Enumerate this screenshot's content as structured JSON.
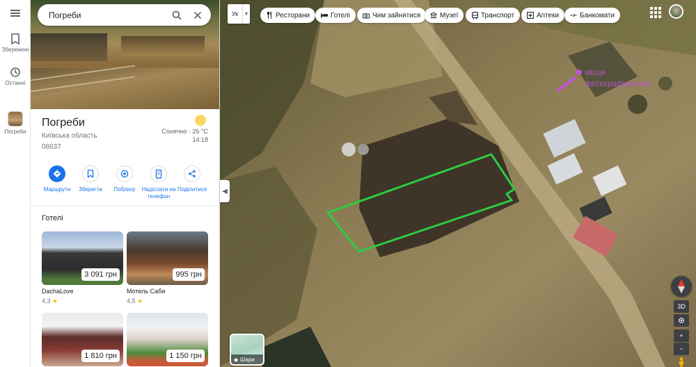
{
  "search": {
    "query": "Погреби"
  },
  "rail": {
    "saved_label": "Збережені",
    "recent_label": "Останні",
    "current_label": "Погреби"
  },
  "place": {
    "title": "Погреби",
    "region": "Київська область",
    "postal_code": "08637",
    "weather": {
      "condition_temp": "Сонячно · 26 °C",
      "time": "14:18",
      "icon": "sun-icon"
    }
  },
  "actions": [
    {
      "label": "Маршрути",
      "icon": "directions-icon"
    },
    {
      "label": "Зберегти",
      "icon": "bookmark-icon"
    },
    {
      "label": "Поблизу",
      "icon": "nearby-icon"
    },
    {
      "label": "Надіслати на телефон",
      "icon": "send-to-phone-icon"
    },
    {
      "label": "Поділитися",
      "icon": "share-icon"
    }
  ],
  "hotels": {
    "title": "Готелі",
    "items": [
      {
        "name": "DachaLove",
        "price": "3 091 грн",
        "rating": "4,3"
      },
      {
        "name": "Мотель Саби",
        "price": "995 грн",
        "rating": "4,5"
      },
      {
        "name": "",
        "price": "1 810 грн",
        "rating": ""
      },
      {
        "name": "",
        "price": "1 150 грн",
        "rating": ""
      }
    ]
  },
  "map": {
    "language_code": "Ук",
    "chips": [
      {
        "label": "Ресторани",
        "icon": "restaurant-icon"
      },
      {
        "label": "Готелі",
        "icon": "hotel-icon"
      },
      {
        "label": "Чим зайнятися",
        "icon": "camera-icon"
      },
      {
        "label": "Музеї",
        "icon": "museum-icon"
      },
      {
        "label": "Транспорт",
        "icon": "transit-icon"
      },
      {
        "label": "Аптеки",
        "icon": "pharmacy-icon"
      },
      {
        "label": "Банкомати",
        "icon": "atm-icon"
      }
    ],
    "annotation_label": "місце фотографування",
    "layers_label": "Шари",
    "tilt_label": "3D",
    "zoom_in": "+",
    "zoom_out": "−",
    "accent_color": "#1a73e8",
    "boundary_color": "#2ecc40",
    "annotation_color": "#c254d6"
  }
}
